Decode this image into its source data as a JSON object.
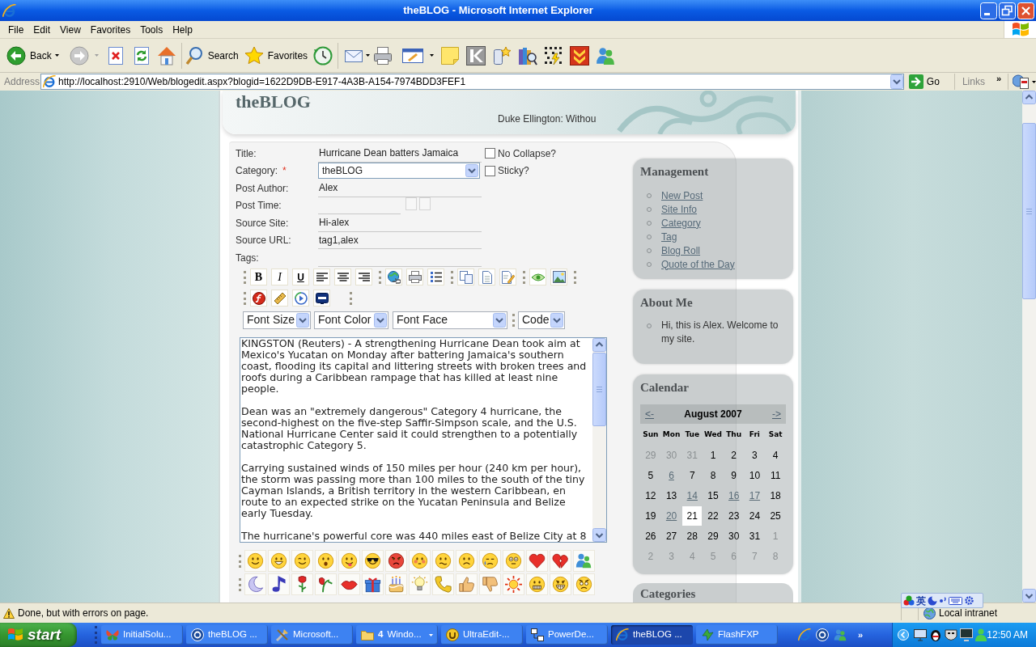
{
  "window": {
    "title": "theBLOG - Microsoft Internet Explorer"
  },
  "menu": [
    "File",
    "Edit",
    "View",
    "Favorites",
    "Tools",
    "Help"
  ],
  "toolbar": {
    "back": "Back",
    "forward": {
      "disabled": true
    },
    "search": "Search",
    "favorites": "Favorites"
  },
  "address_bar": {
    "label": "Address",
    "url": "http://localhost:2910/Web/blogedit.aspx?blogid=1622D9DB-E917-4A3B-A154-7974BDD3FEF1",
    "go": "Go",
    "links": "Links",
    "more": "»"
  },
  "header": {
    "site_title": "theBLOG",
    "quote": "Duke Ellington: Withou"
  },
  "form": {
    "fields": [
      {
        "kind": "text",
        "label": "Title:",
        "value": "Hurricane Dean batters Jamaica",
        "option": {
          "label": "No Collapse?",
          "checked": false
        }
      },
      {
        "kind": "select",
        "label": "Category:",
        "marker": "*",
        "value": "theBLOG",
        "option": {
          "label": "Sticky?",
          "checked": false
        }
      },
      {
        "kind": "text",
        "label": "Post Author:",
        "value": "Alex"
      },
      {
        "kind": "datetime",
        "label": "Post Time:"
      },
      {
        "kind": "text",
        "label": "Source Site:",
        "value": "Hi-alex"
      },
      {
        "kind": "text",
        "label": "Source URL:",
        "value": "tag1,alex"
      },
      {
        "kind": "text",
        "label": "Tags:"
      }
    ]
  },
  "editor": {
    "format_buttons": [
      "B",
      "I",
      "U"
    ],
    "dropdowns": [
      "Font Size",
      "Font Color",
      "Font Face",
      "Code"
    ],
    "body": [
      "KINGSTON (Reuters) - A strengthening Hurricane Dean took aim at Mexico's Yucatan on Monday after battering Jamaica's southern coast, flooding its capital and littering streets with broken trees and roofs during a Caribbean rampage that has killed at least nine people.",
      "Dean was an \"extremely dangerous\" Category 4 hurricane, the second-highest on the five-step Saffir-Simpson scale, and the U.S. National Hurricane Center said it could strengthen to a potentially catastrophic Category 5.",
      "Carrying sustained winds of 150 miles per hour (240 km per hour), the storm was passing more than 100 miles to the south of the tiny Cayman Islands, a British territory in the western Caribbean, en route to an expected strike on the Yucatan Peninsula and Belize early Tuesday.",
      "The hurricane's powerful core was 440 miles east of Belize City at 8"
    ]
  },
  "sidebar": {
    "management": {
      "title": "Management",
      "links": [
        "New Post",
        "Site Info",
        "Category",
        "Tag",
        "Blog Roll",
        "Quote of the Day"
      ]
    },
    "about": {
      "title": "About Me",
      "items": [
        "Hi, this is Alex. Welcome to my site."
      ]
    },
    "calendar": {
      "title": "Calendar",
      "prev": "<-",
      "month": "August 2007",
      "next": "->",
      "weekdays": [
        "Sun",
        "Mon",
        "Tue",
        "Wed",
        "Thu",
        "Fri",
        "Sat"
      ],
      "weeks": [
        [
          {
            "day": "29",
            "kind": "other",
            "selected": false
          },
          {
            "day": "30",
            "kind": "other",
            "selected": false
          },
          {
            "day": "31",
            "kind": "other",
            "selected": false
          },
          {
            "day": "1",
            "kind": "plain",
            "selected": false
          },
          {
            "day": "2",
            "kind": "plain",
            "selected": false
          },
          {
            "day": "3",
            "kind": "plain",
            "selected": false
          },
          {
            "day": "4",
            "kind": "plain",
            "selected": false
          }
        ],
        [
          {
            "day": "5",
            "kind": "plain",
            "selected": false
          },
          {
            "day": "6",
            "kind": "link",
            "selected": false
          },
          {
            "day": "7",
            "kind": "plain",
            "selected": false
          },
          {
            "day": "8",
            "kind": "plain",
            "selected": false
          },
          {
            "day": "9",
            "kind": "plain",
            "selected": false
          },
          {
            "day": "10",
            "kind": "plain",
            "selected": false
          },
          {
            "day": "11",
            "kind": "plain",
            "selected": false
          }
        ],
        [
          {
            "day": "12",
            "kind": "plain",
            "selected": false
          },
          {
            "day": "13",
            "kind": "plain",
            "selected": false
          },
          {
            "day": "14",
            "kind": "link",
            "selected": false
          },
          {
            "day": "15",
            "kind": "plain",
            "selected": false
          },
          {
            "day": "16",
            "kind": "link",
            "selected": false
          },
          {
            "day": "17",
            "kind": "link",
            "selected": false
          },
          {
            "day": "18",
            "kind": "plain",
            "selected": false
          }
        ],
        [
          {
            "day": "19",
            "kind": "plain",
            "selected": false
          },
          {
            "day": "20",
            "kind": "link",
            "selected": false
          },
          {
            "day": "21",
            "kind": "plain",
            "selected": true
          },
          {
            "day": "22",
            "kind": "plain",
            "selected": false
          },
          {
            "day": "23",
            "kind": "plain",
            "selected": false
          },
          {
            "day": "24",
            "kind": "plain",
            "selected": false
          },
          {
            "day": "25",
            "kind": "plain",
            "selected": false
          }
        ],
        [
          {
            "day": "26",
            "kind": "plain",
            "selected": false
          },
          {
            "day": "27",
            "kind": "plain",
            "selected": false
          },
          {
            "day": "28",
            "kind": "plain",
            "selected": false
          },
          {
            "day": "29",
            "kind": "plain",
            "selected": false
          },
          {
            "day": "30",
            "kind": "plain",
            "selected": false
          },
          {
            "day": "31",
            "kind": "plain",
            "selected": false
          },
          {
            "day": "1",
            "kind": "other",
            "selected": false
          }
        ],
        [
          {
            "day": "2",
            "kind": "other",
            "selected": false
          },
          {
            "day": "3",
            "kind": "other",
            "selected": false
          },
          {
            "day": "4",
            "kind": "other",
            "selected": false
          },
          {
            "day": "5",
            "kind": "other",
            "selected": false
          },
          {
            "day": "6",
            "kind": "other",
            "selected": false
          },
          {
            "day": "7",
            "kind": "other",
            "selected": false
          },
          {
            "day": "8",
            "kind": "other",
            "selected": false
          }
        ]
      ]
    },
    "categories": {
      "title": "Categories"
    }
  },
  "status_bar": {
    "message": "Done, but with errors on page.",
    "zone": "Local intranet"
  },
  "language_bar": {
    "mode": "英"
  },
  "taskbar": {
    "start": "start",
    "tasks": [
      {
        "kind": "window",
        "label": "InitialSolu...",
        "selected": false
      },
      {
        "kind": "window",
        "label": "theBLOG ...",
        "selected": false
      },
      {
        "kind": "window",
        "label": "Microsoft...",
        "selected": false
      },
      {
        "kind": "group",
        "count": "4",
        "label": "Windo...",
        "selected": false
      },
      {
        "kind": "window",
        "label": "UltraEdit-...",
        "selected": false
      },
      {
        "kind": "window",
        "label": "PowerDe...",
        "selected": false
      },
      {
        "kind": "window",
        "label": "theBLOG ...",
        "selected": true
      },
      {
        "kind": "window",
        "label": "FlashFXP",
        "selected": false
      }
    ],
    "more": "»",
    "clock": "12:50 AM"
  }
}
